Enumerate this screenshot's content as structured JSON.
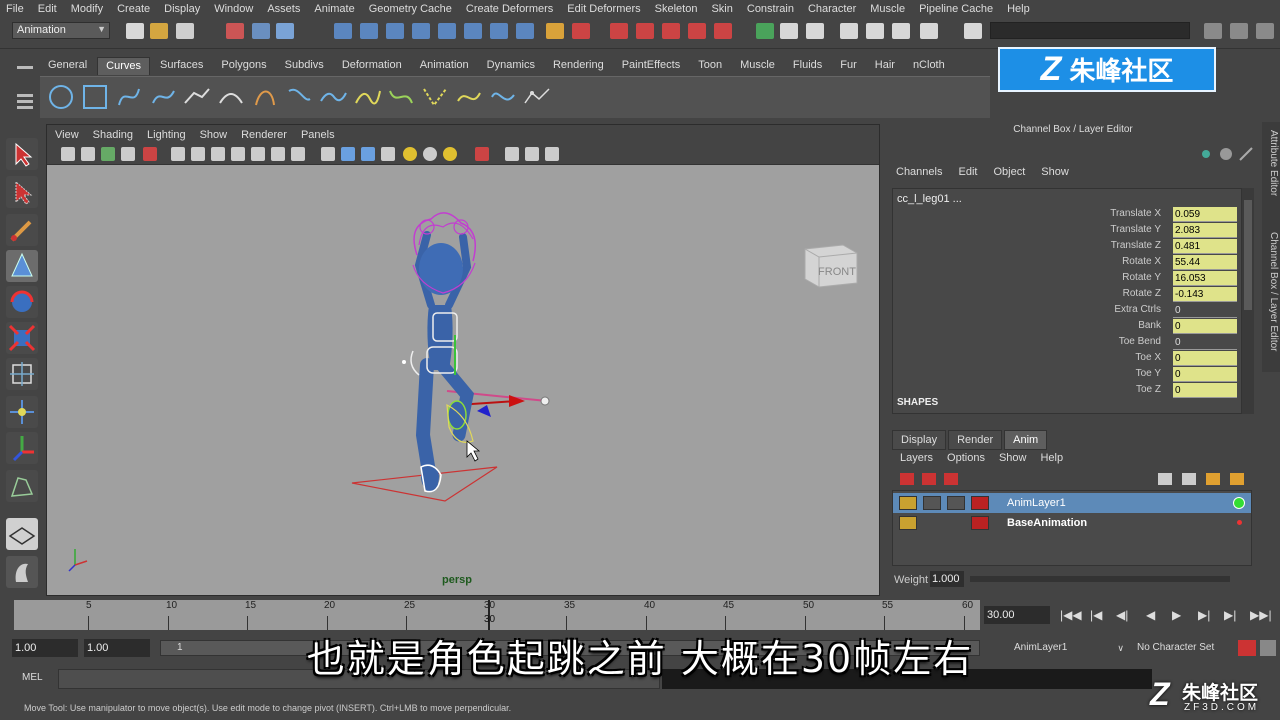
{
  "menubar": [
    "File",
    "Edit",
    "Modify",
    "Create",
    "Display",
    "Window",
    "Assets",
    "Animate",
    "Geometry Cache",
    "Create Deformers",
    "Edit Deformers",
    "Skeleton",
    "Skin",
    "Constrain",
    "Character",
    "Muscle",
    "Pipeline Cache",
    "Help"
  ],
  "statusline": {
    "mode": "Animation"
  },
  "shelf": {
    "tabs": [
      "General",
      "Curves",
      "Surfaces",
      "Polygons",
      "Subdivs",
      "Deformation",
      "Animation",
      "Dynamics",
      "Rendering",
      "PaintEffects",
      "Toon",
      "Muscle",
      "Fluids",
      "Fur",
      "Hair",
      "nCloth"
    ],
    "active_tab": "Curves"
  },
  "watermark_top": {
    "text": "朱峰社区",
    "logo": "Z"
  },
  "viewport": {
    "menu": [
      "View",
      "Shading",
      "Lighting",
      "Show",
      "Renderer",
      "Panels"
    ],
    "camera": "persp",
    "viewcube_face": "FRONT"
  },
  "channel_box": {
    "title": "Channel Box / Layer Editor",
    "menu": [
      "Channels",
      "Edit",
      "Object",
      "Show"
    ],
    "object": "cc_l_leg01 ...",
    "channels": [
      {
        "label": "Translate X",
        "value": "0.059",
        "keyed": true
      },
      {
        "label": "Translate Y",
        "value": "2.083",
        "keyed": true
      },
      {
        "label": "Translate Z",
        "value": "0.481",
        "keyed": true
      },
      {
        "label": "Rotate X",
        "value": "55.44",
        "keyed": true
      },
      {
        "label": "Rotate Y",
        "value": "16.053",
        "keyed": true
      },
      {
        "label": "Rotate Z",
        "value": "-0.143",
        "keyed": true
      },
      {
        "label": "Extra Ctrls",
        "value": "0",
        "keyed": false
      },
      {
        "label": "Bank",
        "value": "0",
        "keyed": true
      },
      {
        "label": "Toe Bend",
        "value": "0",
        "keyed": false
      },
      {
        "label": "Toe X",
        "value": "0",
        "keyed": true
      },
      {
        "label": "Toe Y",
        "value": "0",
        "keyed": true
      },
      {
        "label": "Toe Z",
        "value": "0",
        "keyed": true
      }
    ],
    "shapes_label": "SHAPES"
  },
  "side_tabs": [
    "Attribute Editor",
    "Channel Box / Layer Editor"
  ],
  "layer_editor": {
    "tabs": [
      "Display",
      "Render",
      "Anim"
    ],
    "active_tab": "Anim",
    "menu": [
      "Layers",
      "Options",
      "Show",
      "Help"
    ],
    "layers": [
      {
        "name": "AnimLayer1",
        "selected": true
      },
      {
        "name": "BaseAnimation",
        "selected": false
      }
    ],
    "weight_label": "Weight",
    "weight_value": "1.000"
  },
  "timeslider": {
    "ticks": [
      "5",
      "10",
      "15",
      "20",
      "25",
      "30",
      "35",
      "40",
      "45",
      "50",
      "55",
      "60"
    ],
    "current_frame_label": "30",
    "current_frame_field": "30.00"
  },
  "range": {
    "start": "1.00",
    "start2": "1.00",
    "range_start": "1",
    "anim_layer": "AnimLayer1",
    "character_set": "No Character Set"
  },
  "cmdline": {
    "label": "MEL"
  },
  "helpline": {
    "text": "Move Tool: Use manipulator to move object(s). Use edit mode to change pivot (INSERT). Ctrl+LMB to move perpendicular."
  },
  "subtitle": "也就是角色起跳之前  大概在30帧左右",
  "watermark_bottom": {
    "brand": "朱峰社区",
    "domain": "ZF3D.COM",
    "logo": "Z"
  },
  "colors": {
    "keyed": "#dfe38a",
    "selected_layer": "#5d8ab8",
    "watermark_blue": "#1d8fe6"
  }
}
